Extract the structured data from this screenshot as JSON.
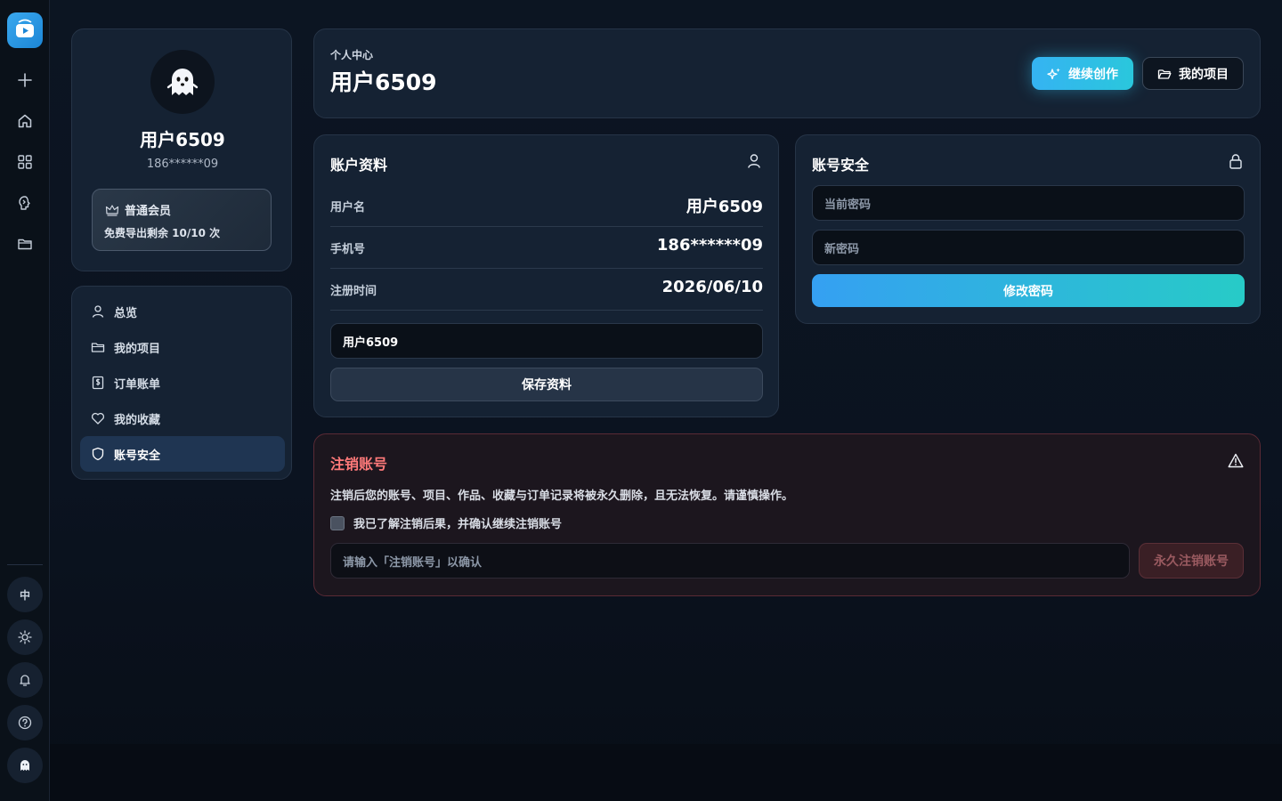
{
  "rail": {
    "logo_icon": "play-box-icon",
    "items": [
      {
        "icon": "plus-icon",
        "name": "rail-new"
      },
      {
        "icon": "home-icon",
        "name": "rail-home"
      },
      {
        "icon": "grid-icon",
        "name": "rail-apps"
      },
      {
        "icon": "ai-icon",
        "name": "rail-ai"
      },
      {
        "icon": "folder-icon",
        "name": "rail-folder"
      }
    ],
    "lang_label": "中"
  },
  "profile": {
    "name": "用户6509",
    "phone": "186******09",
    "member_title": "普通会员",
    "member_sub": "免费导出剩余 10/10 次"
  },
  "nav": {
    "items": [
      {
        "label": "总览",
        "icon": "user-icon"
      },
      {
        "label": "我的项目",
        "icon": "folder-icon"
      },
      {
        "label": "订单账单",
        "icon": "bill-icon"
      },
      {
        "label": "我的收藏",
        "icon": "heart-icon"
      },
      {
        "label": "账号安全",
        "icon": "shield-icon",
        "active": true
      }
    ]
  },
  "header": {
    "crumb": "个人中心",
    "title": "用户6509",
    "continue_label": "继续创作",
    "projects_label": "我的项目"
  },
  "account": {
    "title": "账户资料",
    "rows": [
      {
        "label": "用户名",
        "value": "用户6509"
      },
      {
        "label": "手机号",
        "value": "186******09"
      },
      {
        "label": "注册时间",
        "value": "2026/06/10"
      }
    ],
    "name_input_value": "用户6509",
    "save_label": "保存资料"
  },
  "security": {
    "title": "账号安全",
    "current_password_placeholder": "当前密码",
    "new_password_placeholder": "新密码",
    "change_label": "修改密码"
  },
  "danger": {
    "title": "注销账号",
    "description": "注销后您的账号、项目、作品、收藏与订单记录将被永久删除，且无法恢复。请谨慎操作。",
    "checkbox_label": "我已了解注销后果，并确认继续注销账号",
    "confirm_placeholder": "请输入「注销账号」以确认",
    "delete_label": "永久注销账号"
  },
  "colors": {
    "accent": "#35b3f2",
    "danger": "#ff7a7a",
    "card": "#152233"
  }
}
